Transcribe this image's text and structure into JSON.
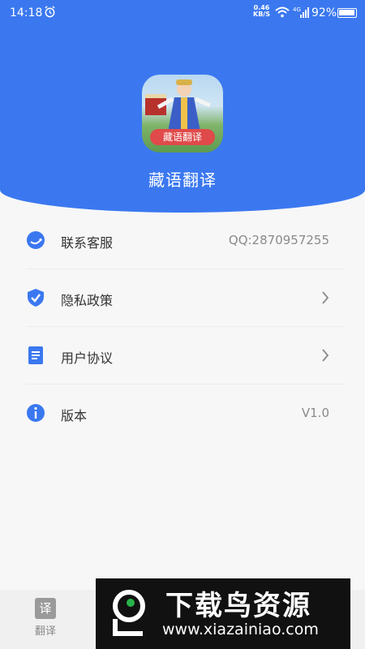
{
  "status_bar": {
    "time": "14:18",
    "network_speed": "0.46",
    "network_unit": "KB/S",
    "signal_type": "4G",
    "battery_percent": "92%"
  },
  "app": {
    "logo_badge": "藏语翻译",
    "name": "藏语翻译"
  },
  "menu": {
    "items": [
      {
        "label": "联系客服",
        "value": "QQ:2870957255",
        "icon": "headset-icon"
      },
      {
        "label": "隐私政策",
        "icon": "shield-check-icon",
        "chevron": true
      },
      {
        "label": "用户协议",
        "icon": "document-icon",
        "chevron": true
      },
      {
        "label": "版本",
        "value": "V1.0",
        "icon": "info-icon"
      }
    ]
  },
  "tabbar": {
    "tabs": [
      {
        "label": "翻译",
        "icon_char": "译"
      }
    ]
  },
  "watermark": {
    "title": "下载鸟资源",
    "url": "www.xiazainiao.com"
  },
  "colors": {
    "primary": "#3b78f0",
    "text": "#333333",
    "muted": "#8a8a8a"
  }
}
